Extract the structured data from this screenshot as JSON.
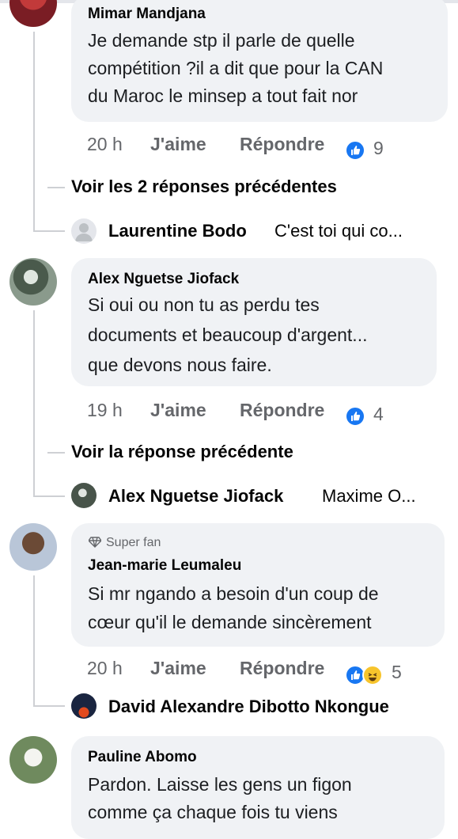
{
  "comments": [
    {
      "author": "Mimar Mandjana",
      "lines": [
        "Je demande stp il parle de quelle",
        "compétition ?il a dit que pour la CAN",
        "du Maroc le minsep a tout fait nor"
      ],
      "time": "20 h",
      "like_label": "J'aime",
      "reply_label": "Répondre",
      "reaction_count": "9",
      "see_previous": "Voir les 2 réponses précédentes",
      "latest_reply": {
        "name": "Laurentine Bodo",
        "snippet": "C'est toi qui co..."
      }
    },
    {
      "author": "Alex Nguetse Jiofack",
      "lines": [
        "Si oui ou non tu as perdu tes",
        "documents et beaucoup d'argent...",
        "que devons nous faire."
      ],
      "time": "19 h",
      "like_label": "J'aime",
      "reply_label": "Répondre",
      "reaction_count": "4",
      "see_previous": "Voir la réponse précédente",
      "latest_reply": {
        "name": "Alex Nguetse Jiofack",
        "snippet": "Maxime O..."
      }
    },
    {
      "badge": "Super fan",
      "author": "Jean-marie Leumaleu",
      "lines": [
        "Si mr ngando a besoin d'un coup de",
        "cœur qu'il le demande sincèrement"
      ],
      "time": "20 h",
      "like_label": "J'aime",
      "reply_label": "Répondre",
      "reaction_count": "5",
      "latest_reply": {
        "name": "David Alexandre Dibotto Nkongue",
        "snippet": ""
      }
    },
    {
      "author": "Pauline Abomo",
      "lines": [
        "Pardon. Laisse les gens un figon",
        "comme ça chaque fois tu viens"
      ]
    }
  ],
  "colors": {
    "bubble": "#f0f2f5",
    "like_blue": "#1877f2",
    "haha_yellow": "#f7c42c",
    "meta_grey": "#65676b"
  },
  "icons": [
    "like-icon",
    "haha-icon",
    "super-fan-diamond-icon",
    "default-avatar-icon"
  ]
}
